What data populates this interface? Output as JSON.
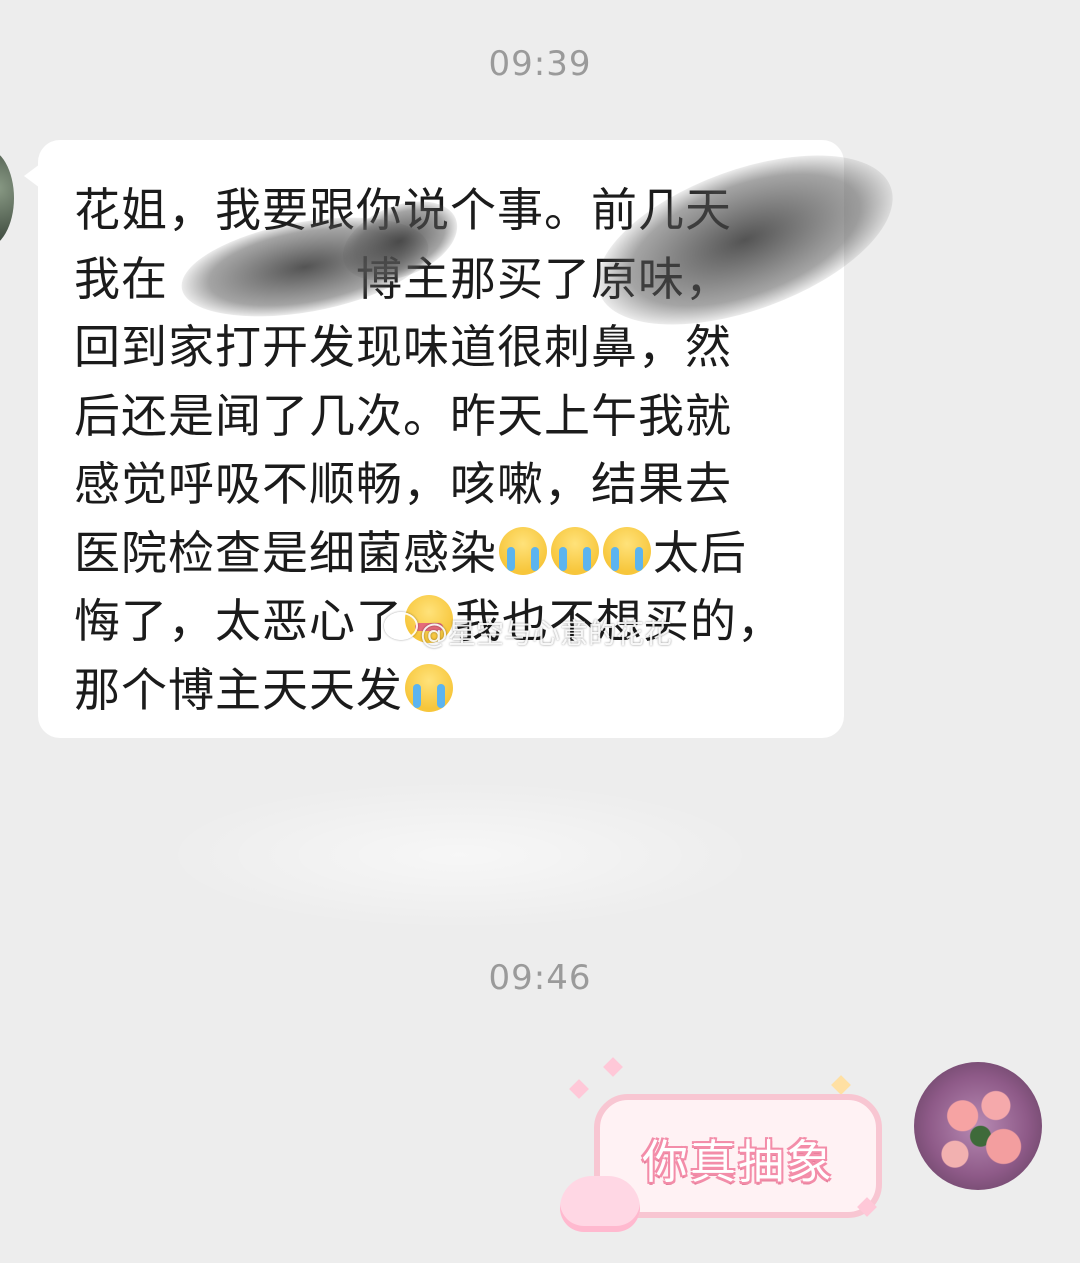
{
  "chat": {
    "timestamps": [
      "09:39",
      "09:46"
    ],
    "incoming_message": {
      "lines": [
        "花姐，我要跟你说个事。前几天",
        "我在",
        "博主那买了原味，",
        "回到家打开发现味道很刺鼻，然",
        "后还是闻了几次。昨天上午我就",
        "感觉呼吸不顺畅，咳嗽，结果去",
        "医院检查是细菌感染",
        "太后",
        "悔了，太恶心了",
        "我也不想买的，",
        "那个博主天天发"
      ],
      "emojis": [
        "loudly-crying-face",
        "tired-face"
      ]
    },
    "outgoing_message": {
      "text": "你真抽象",
      "style": "pink-sticker-bubble"
    },
    "watermark": "@星空与心意的花花"
  },
  "colors": {
    "background": "#ededed",
    "incoming_bubble": "#ffffff",
    "outgoing_bubble_border": "#f8c6d2",
    "outgoing_text_outline": "#f38da9",
    "timestamp": "#9a9a9a"
  }
}
